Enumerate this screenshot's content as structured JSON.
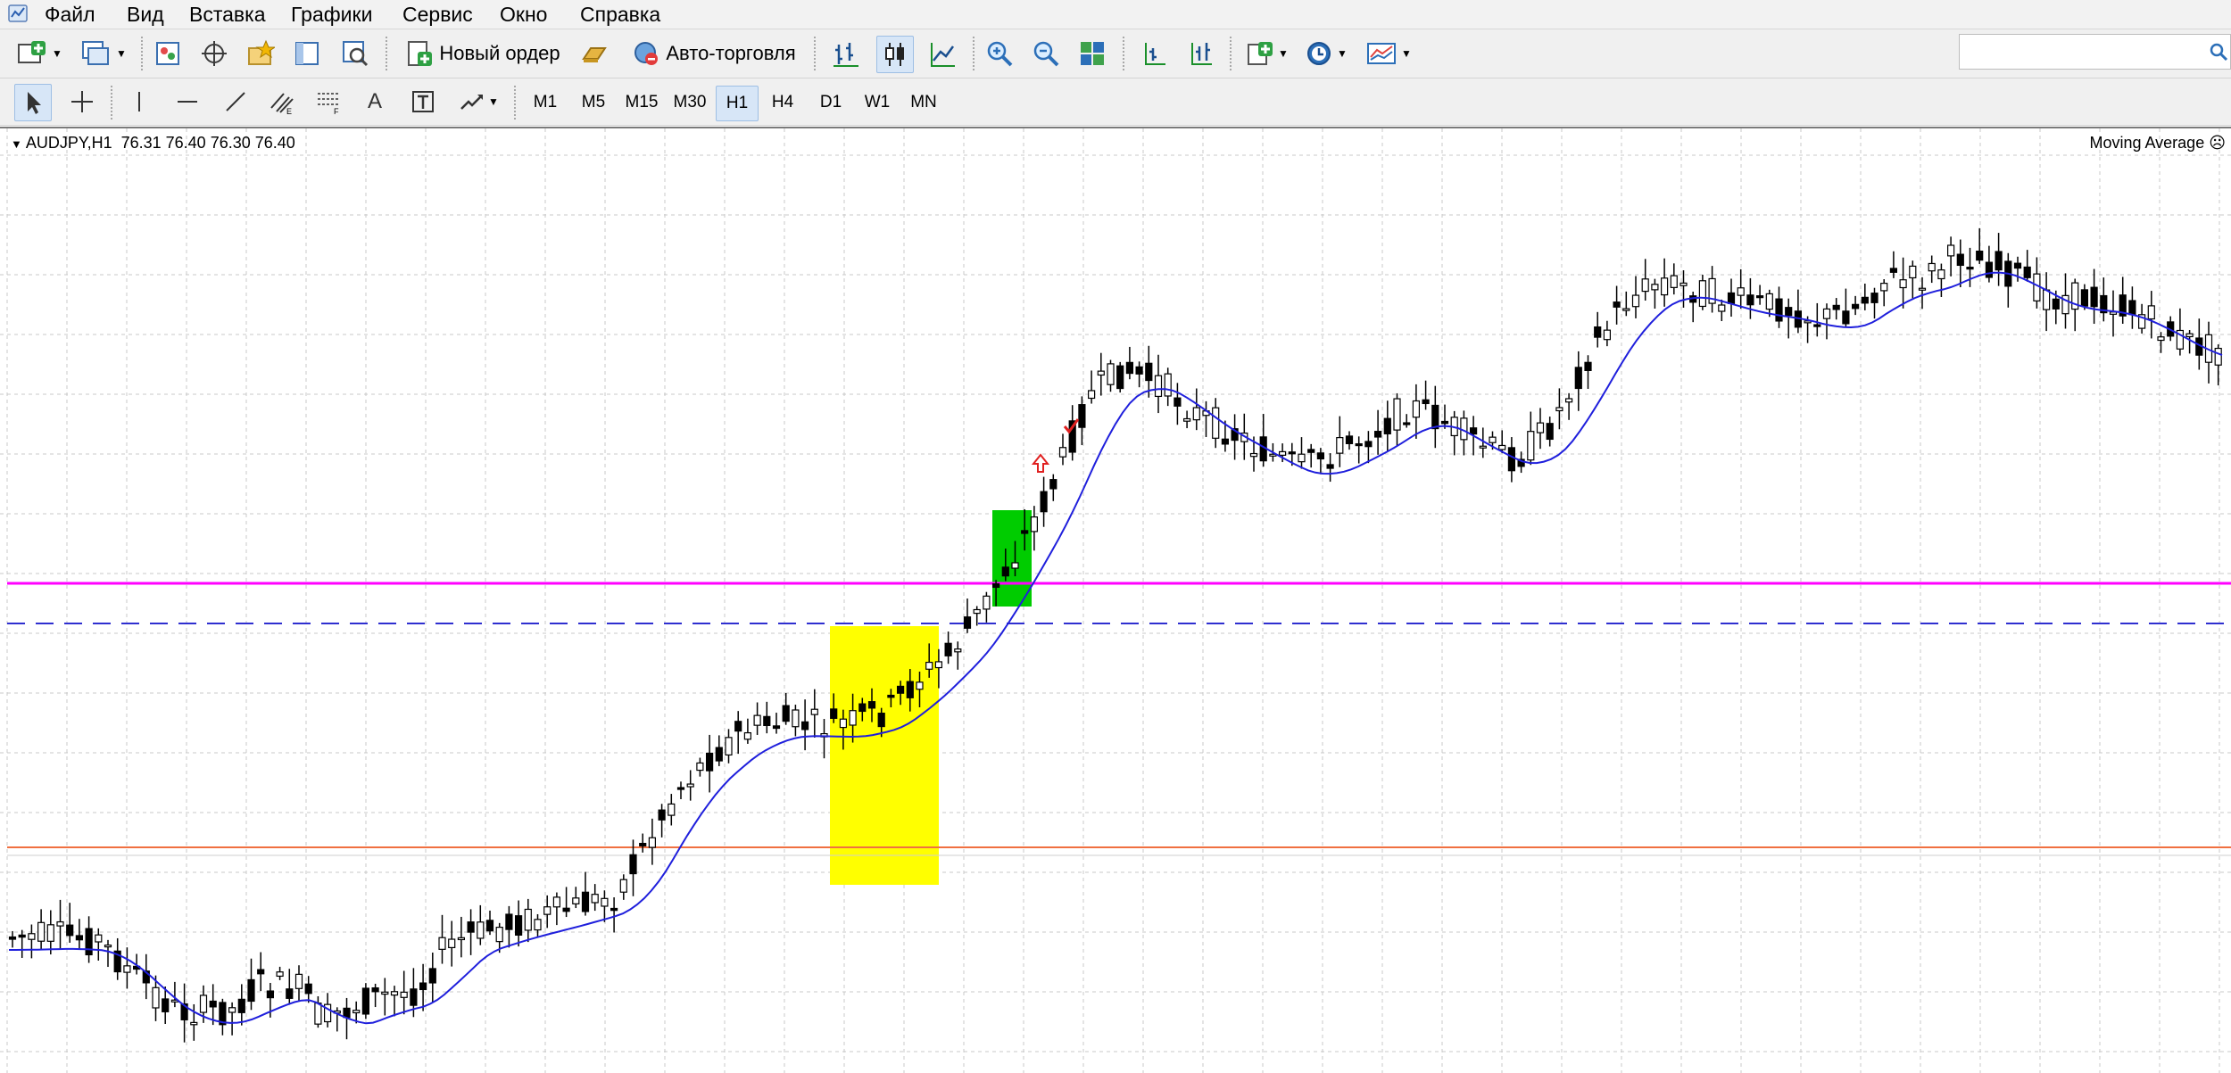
{
  "menu": [
    "Файл",
    "Вид",
    "Вставка",
    "Графики",
    "Сервис",
    "Окно",
    "Справка"
  ],
  "toolbar1": {
    "new_order_label": "Новый ордер",
    "auto_trading_label": "Авто-торговля"
  },
  "toolbar2": {
    "text_tool": "A",
    "timeframes": [
      "M1",
      "M5",
      "M15",
      "M30",
      "H1",
      "H4",
      "D1",
      "W1",
      "MN"
    ],
    "active_timeframe": "H1"
  },
  "chart": {
    "header": "AUDJPY,H1  76.31 76.40 76.30 76.40",
    "indicator_label": "Moving Average",
    "colors": {
      "candle": "#000000",
      "moving_average": "#1f1fdc",
      "magenta_line": "#ff00ff",
      "dashed_line": "#2f2fd0",
      "orange_line": "#f07040",
      "yellow_zone": "#ffff00",
      "green_zone": "#00cc00",
      "grid": "#c8c8c8"
    }
  }
}
